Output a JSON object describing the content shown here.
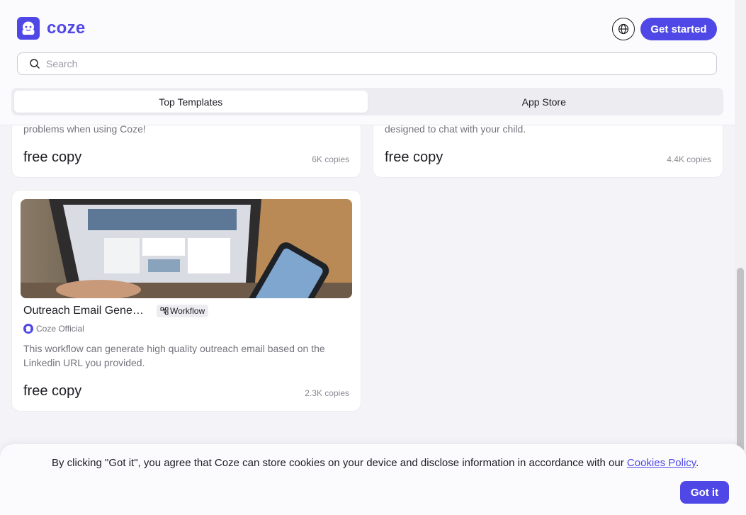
{
  "header": {
    "logo_text": "coze",
    "get_started_label": "Get started",
    "search_placeholder": "Search"
  },
  "tabs": [
    {
      "label": "Top Templates",
      "active": true
    },
    {
      "label": "App Store",
      "active": false
    }
  ],
  "cards": [
    {
      "description_tail": "problems when using Coze!",
      "price": "free copy",
      "copies": "6K copies"
    },
    {
      "description_tail": "designed to chat with your child.",
      "price": "free copy",
      "copies": "4.4K copies"
    },
    {
      "title": "Outreach Email Gene…",
      "tag": "Workflow",
      "author": "Coze Official",
      "description": "This workflow can generate high quality outreach email based on the Linkedin URL you provided.",
      "price": "free copy",
      "copies": "2.3K copies"
    }
  ],
  "cookie": {
    "text": "By clicking \"Got it\", you agree that Coze can store cookies on your device and disclose information in accordance with our ",
    "link_text": "Cookies Policy",
    "text_end": ".",
    "button_label": "Got it"
  },
  "colors": {
    "brand": "#4f48e6",
    "background": "#f4f4f8"
  }
}
